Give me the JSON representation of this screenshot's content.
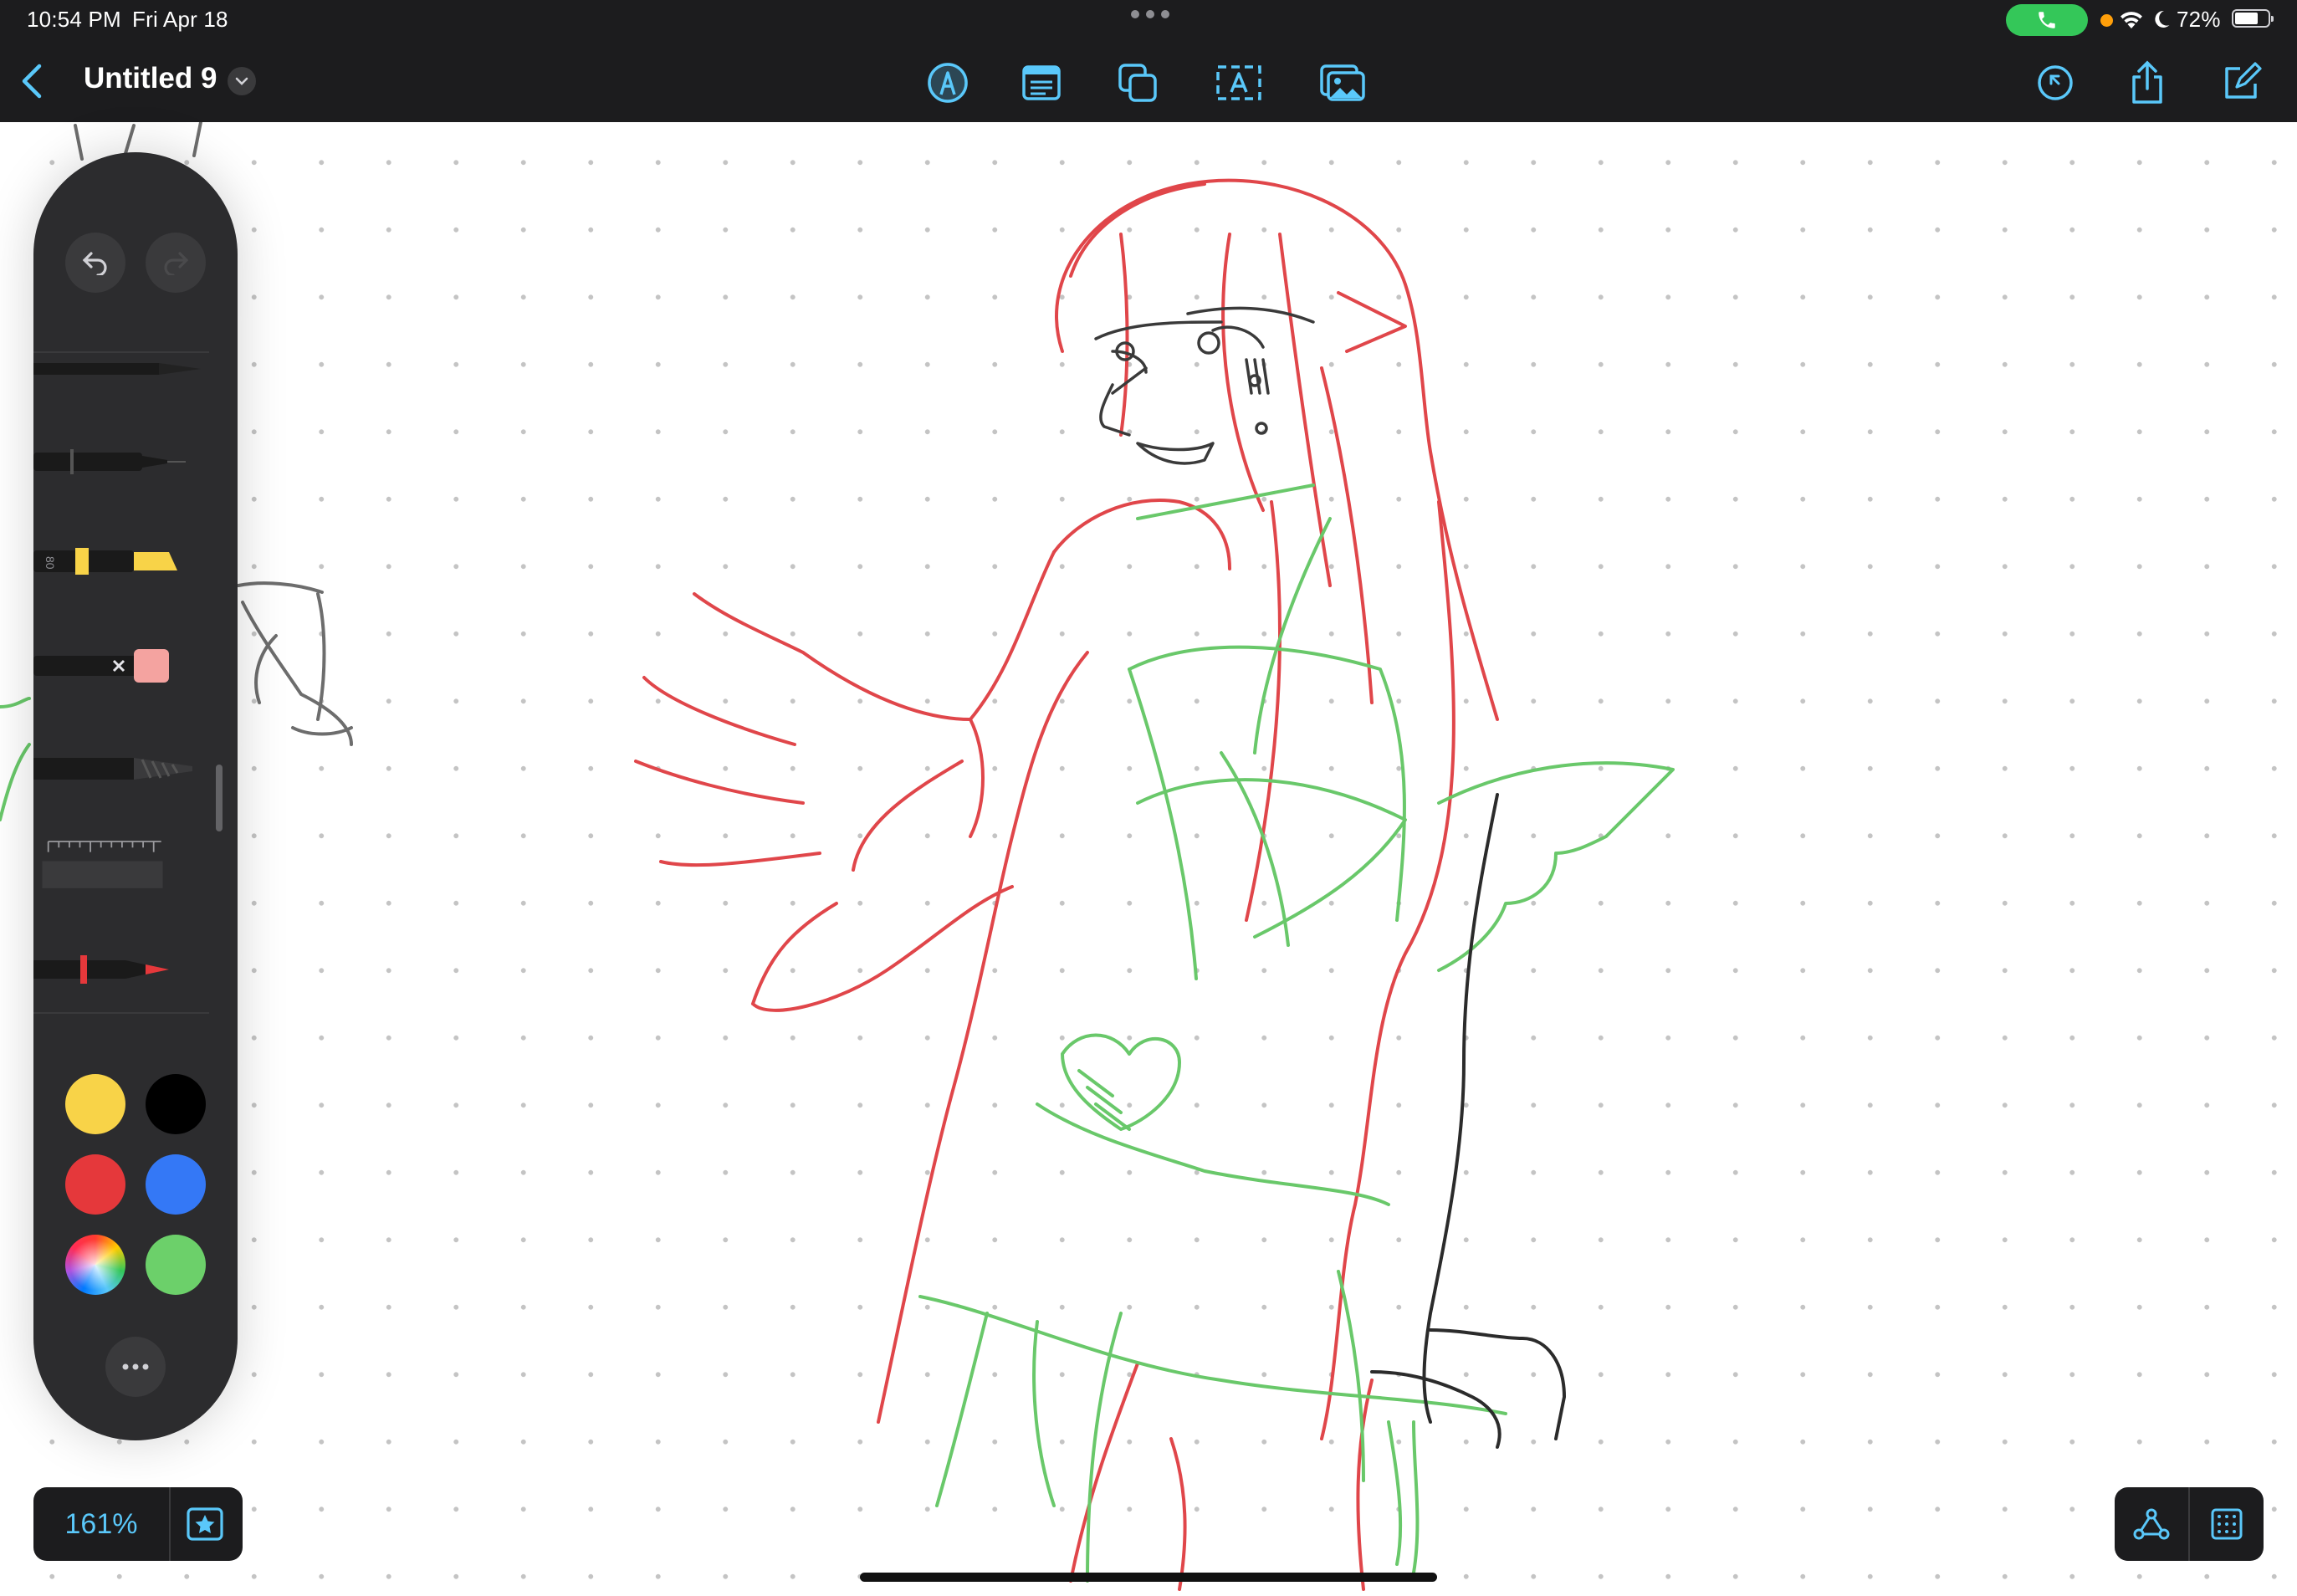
{
  "status_bar": {
    "time": "10:54 PM",
    "date": "Fri Apr 18",
    "battery": "72%",
    "battery_level": 0.72,
    "call_pill_color": "#34c759",
    "icons": [
      "phone-icon",
      "wifi-icon",
      "moon-icon",
      "battery-icon"
    ]
  },
  "title_bar": {
    "back_icon": "chevron-left-icon",
    "document_title": "Untitled 9",
    "title_menu_icon": "chevron-down-icon",
    "center_tools": [
      "pen-tool-icon",
      "text-box-icon",
      "shapes-icon",
      "text-icon",
      "image-icon"
    ],
    "right_tools": [
      "history-icon",
      "share-icon",
      "new-board-icon"
    ],
    "accent_color": "#5ac8fa"
  },
  "tool_palette": {
    "undo_icon": "undo-icon",
    "redo_icon": "redo-icon",
    "tools": [
      "pen-icon",
      "fineliner-icon",
      "highlighter-icon",
      "eraser-icon",
      "pencil-icon",
      "ruler-icon",
      "crayon-icon"
    ],
    "highlighter_label": "80",
    "swatches": [
      {
        "name": "yellow",
        "color": "#f8d348"
      },
      {
        "name": "black",
        "color": "#000000"
      },
      {
        "name": "red",
        "color": "#e5383b"
      },
      {
        "name": "blue",
        "color": "#3478f6"
      },
      {
        "name": "multicolor",
        "color": "conic"
      },
      {
        "name": "green",
        "color": "#6cd06a"
      }
    ],
    "more_icon": "ellipsis-icon"
  },
  "zoom": {
    "level": "161%",
    "favorite_icon": "star-icon"
  },
  "canvas_options": {
    "icons": [
      "connections-icon",
      "grid-icon"
    ]
  }
}
